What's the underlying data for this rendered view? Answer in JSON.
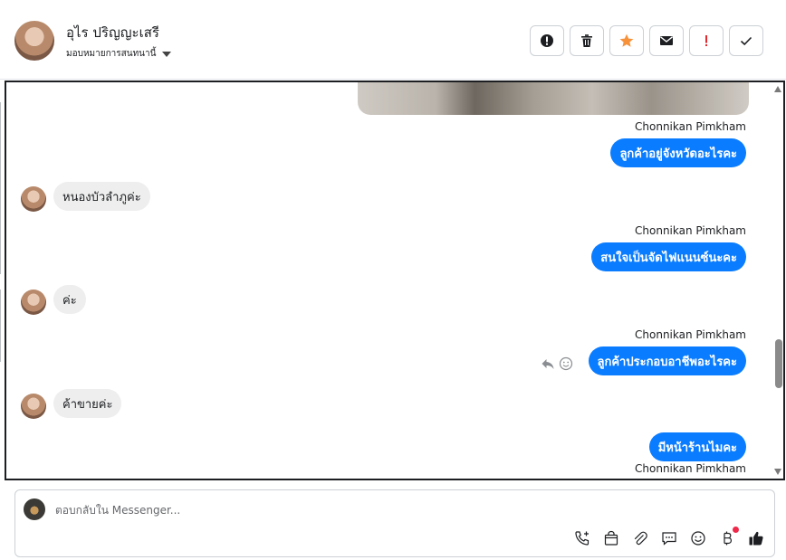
{
  "header": {
    "contact_name": "อุไร ปริญญะเสรี",
    "assign_label": "มอบหมายการสนทนานี้",
    "actions": [
      {
        "name": "spam",
        "icon": "alert-circle-icon"
      },
      {
        "name": "delete",
        "icon": "trash-icon"
      },
      {
        "name": "star",
        "icon": "star-icon",
        "color": "#f7923b"
      },
      {
        "name": "mark-unread",
        "icon": "envelope-icon"
      },
      {
        "name": "important",
        "icon": "exclamation-icon",
        "color": "#e4282e"
      },
      {
        "name": "done",
        "icon": "check-icon"
      }
    ]
  },
  "messages": [
    {
      "sender": "Chonnikan Pimkham",
      "text": "ลูกค้าอยู่จังหวัดอะไรคะ",
      "direction": "out"
    },
    {
      "text": "หนองบัวลำภูค่ะ",
      "direction": "in"
    },
    {
      "sender": "Chonnikan Pimkham",
      "text": "สนใจเป็นจัดไฟแนนซ์นะคะ",
      "direction": "out"
    },
    {
      "text": "ค่ะ",
      "direction": "in"
    },
    {
      "sender": "Chonnikan Pimkham",
      "text": "ลูกค้าประกอบอาชีพอะไรคะ",
      "direction": "out"
    },
    {
      "text": "ค้าขายค่ะ",
      "direction": "in"
    },
    {
      "text": "มีหน้าร้านไมคะ",
      "direction": "out"
    },
    {
      "sender": "Chonnikan Pimkham",
      "direction": "out"
    }
  ],
  "composer": {
    "placeholder": "ตอบกลับใน Messenger..."
  },
  "colors": {
    "outgoing_bubble": "#0a7cff",
    "incoming_bubble": "#eeeeee",
    "like": "#1c1e21",
    "notification_dot": "#f02849"
  }
}
